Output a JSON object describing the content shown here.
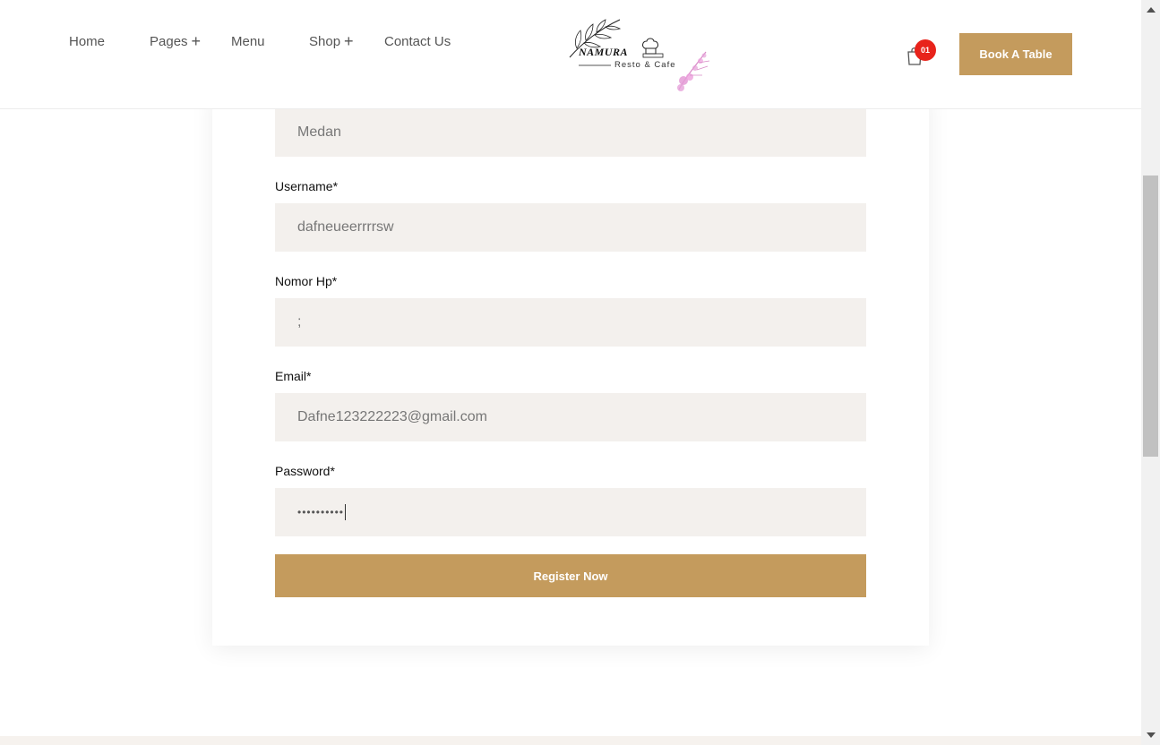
{
  "nav": {
    "home": "Home",
    "pages": "Pages",
    "menu": "Menu",
    "shop": "Shop",
    "contact": "Contact Us",
    "plus": "+"
  },
  "logo": {
    "brand": "NAMURA",
    "tagline": "Resto & Cafe"
  },
  "cart": {
    "count": "01"
  },
  "header_cta": "Book A Table",
  "form": {
    "city_value": "Medan",
    "username_label": "Username*",
    "username_value": "dafneueerrrrsw",
    "phone_label": "Nomor Hp*",
    "phone_value": ";",
    "email_label": "Email*",
    "email_value": "Dafne123222223@gmail.com",
    "password_label": "Password*",
    "password_masked": "••••••••••",
    "submit_label": "Register Now"
  },
  "colors": {
    "accent": "#c49b5d",
    "badge": "#e8231b",
    "field_bg": "#f3f0ed"
  }
}
